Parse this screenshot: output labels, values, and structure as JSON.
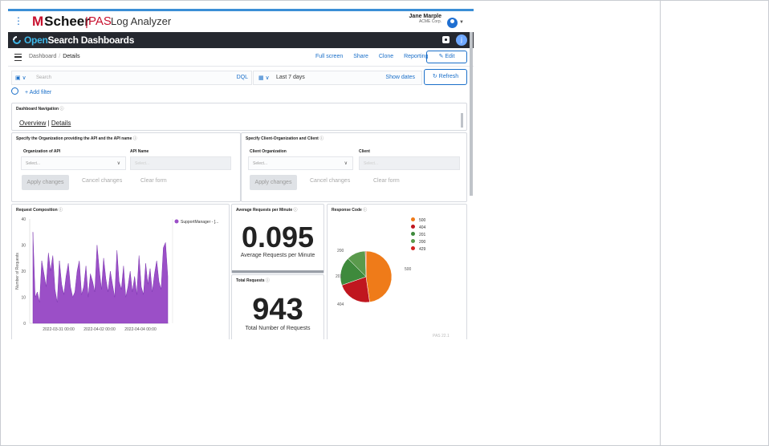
{
  "brand": {
    "logo": "Scheer",
    "sub": "PAS",
    "app_title": "Log Analyzer",
    "user_name": "Jane Marple",
    "user_org": "ACME Corp."
  },
  "os": {
    "name_open": "Open",
    "name_rest": "Search Dashboards",
    "user_initial": "j"
  },
  "nav": {
    "crumb_root": "Dashboard",
    "crumb_current": "Details",
    "links": [
      "Full screen",
      "Share",
      "Clone",
      "Reporting"
    ],
    "edit": "Edit"
  },
  "query": {
    "placeholder": "Search",
    "dql": "DQL",
    "date_range": "Last 7 days",
    "show_dates": "Show dates",
    "refresh": "Refresh",
    "add_filter": "+ Add filter"
  },
  "panels": {
    "dashboard_nav": {
      "title": "Dashboard Navigation",
      "link_overview": "Overview",
      "sep": "|",
      "link_details": "Details"
    },
    "api_filter": {
      "title": "Specify the Organization providing the API and the API name",
      "label_org": "Organization of API",
      "label_api": "API Name",
      "select_ph": "Select...",
      "apply": "Apply changes",
      "cancel": "Cancel changes",
      "clear": "Clear form"
    },
    "client_filter": {
      "title": "Specify Client-Organization and Client",
      "label_org": "Client Organization",
      "label_client": "Client",
      "select_ph": "Select...",
      "apply": "Apply changes",
      "cancel": "Cancel changes",
      "clear": "Clear form"
    },
    "request_comp": {
      "title": "Request Composition",
      "legend": "SupportManager - [..."
    },
    "avg": {
      "title": "Average Requests per Minute",
      "value": "0.095",
      "label": "Average Requests per Minute"
    },
    "total": {
      "title": "Total Requests",
      "value": "943",
      "label": "Total Number of Requests"
    },
    "response": {
      "title": "Response Code"
    }
  },
  "footer_version": "PAS 22.1",
  "colors": {
    "area": "#9b4fc7",
    "code_500": "#ef7b19",
    "code_404": "#c0161f",
    "code_201": "#3e8a3c",
    "code_200": "#5a9a4c",
    "code_429": "#d2221f"
  },
  "chart_data": [
    {
      "type": "area",
      "ylabel": "Number of Requests",
      "ylim": [
        0,
        40
      ],
      "yticks": [
        0,
        10,
        20,
        30,
        40
      ],
      "xticks": [
        "2022-03-31 00:00",
        "2022-04-02 00:00",
        "2022-04-04 00:00"
      ],
      "series": [
        {
          "name": "SupportManager - [...",
          "values": [
            35,
            10,
            12,
            8,
            24,
            19,
            14,
            27,
            20,
            26,
            13,
            8,
            24,
            15,
            11,
            18,
            23,
            14,
            10,
            12,
            20,
            24,
            11,
            14,
            22,
            10,
            19,
            16,
            12,
            30,
            21,
            13,
            25,
            17,
            12,
            20,
            15,
            10,
            28,
            16,
            13,
            22,
            10,
            14,
            20,
            12,
            18,
            11,
            26,
            14,
            11,
            23,
            15,
            21,
            12,
            19,
            24,
            16,
            13,
            29,
            31,
            18
          ]
        }
      ]
    },
    {
      "type": "pie",
      "categories": [
        "500",
        "404",
        "201",
        "200",
        "429"
      ],
      "values": [
        48,
        22,
        18,
        12,
        0.5
      ],
      "slice_labels": [
        "500",
        "404",
        "201",
        "200"
      ]
    }
  ]
}
